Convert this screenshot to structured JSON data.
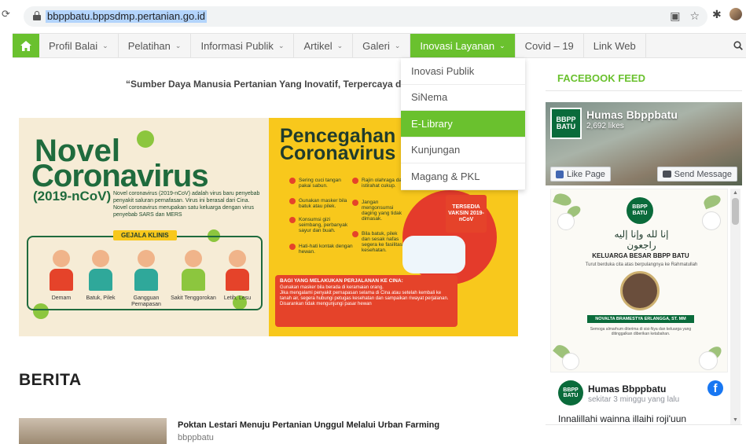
{
  "browser": {
    "url": "bbppbatu.bppsdmp.pertanian.go.id"
  },
  "nav": {
    "items": [
      {
        "label": "Profil Balai",
        "has_dropdown": true
      },
      {
        "label": "Pelatihan",
        "has_dropdown": true
      },
      {
        "label": "Informasi Publik",
        "has_dropdown": true
      },
      {
        "label": "Artikel",
        "has_dropdown": true
      },
      {
        "label": "Galeri",
        "has_dropdown": true
      },
      {
        "label": "Inovasi Layanan",
        "has_dropdown": true,
        "active": true
      },
      {
        "label": "Covid – 19",
        "has_dropdown": false
      },
      {
        "label": "Link Web",
        "has_dropdown": false
      }
    ],
    "accent": "#6ac12e"
  },
  "dropdown": {
    "items": [
      "Inovasi Publik",
      "SiNema",
      "E-Library",
      "Kunjungan",
      "Magang & PKL"
    ],
    "active_index": 2
  },
  "tagline": "“Sumber Daya Manusia Pertanian Yang Inovatif, Terpercaya dan Mandi",
  "banner": {
    "left": {
      "title_line1": "Novel",
      "title_line2": "Coronavirus",
      "subtitle": "(2019-nCoV)",
      "description": "Novel coronavirus (2019-nCoV) adalah virus baru penyebab penyakit saluran pernafasan. Virus ini berasal dari Cina. Novel coronavirus merupakan satu keluarga dengan virus penyebab SARS dan MERS",
      "gejala_label": "GEJALA KLINIS",
      "symptoms": [
        "Demam",
        "Batuk, Pilek",
        "Gangguan Pernapasan",
        "Sakit Tenggorokan",
        "Letih, Lesu"
      ]
    },
    "right": {
      "title_line1": "Pencegahan",
      "title_line2": "Coronavirus",
      "tips_left": [
        "Sering cuci tangan pakai sabun.",
        "Gunakan masker bila batuk atau pilek.",
        "Konsumsi gizi seimbang, perbanyak sayur dan buah.",
        "Hati-hati kontak dengan hewan."
      ],
      "tips_right": [
        "Rajin olahraga dan istirahat cukup.",
        "Jangan mengonsumsi daging yang tidak dimasak.",
        "Bila batuk, pilek dan sesak nafas segera ke fasilitas kesehatan."
      ],
      "vaksin_badge": "TERSEDIA VAKSIN 2019-nCoV",
      "travel_title": "BAGI YANG MELAKUKAN PERJALANAN KE CINA:",
      "travel_tips": [
        "Gunakan masker bila berada di keramaian orang.",
        "Jika mengalami penyakit pernapasan selama di Cina atau setelah kembali ke tanah air, segera hubungi petugas kesehatan dan sampaikan riwayat perjalanan.",
        "Disarankan tidak mengunjungi pasar hewan"
      ]
    }
  },
  "berita": {
    "heading": "BERITA",
    "items": [
      {
        "title": "Poktan Lestari Menuju Pertanian Unggul Melalui Urban Farming",
        "author": "bbppbatu"
      }
    ]
  },
  "sidebar": {
    "heading": "FACEBOOK FEED",
    "page": {
      "logo_text": "BBPP BATU",
      "name": "Humas Bbppbatu",
      "likes": "2,692 likes",
      "like_button": "Like Page",
      "message_button": "Send Message"
    },
    "post_image": {
      "logo_text": "BBPP BATU",
      "arabic": "إنا لله وإنا إليه راجعون",
      "family": "KELUARGA BESAR BBPP BATU",
      "sub": "Turut berduka cita atas berpulangnya ke Rahmatullah",
      "deceased": "NOVALTA BRAMESTYA ERLANGGA, ST. MM",
      "text": "Semoga almarhum diterima di sisi-Nya dan keluarga yang ditinggalkan diberikan ketabahan."
    },
    "post": {
      "author": "Humas Bbppbatu",
      "time": "sekitar 3 minggu yang lalu",
      "text": "Innalillahi wainna illaihi roji'uun"
    }
  }
}
